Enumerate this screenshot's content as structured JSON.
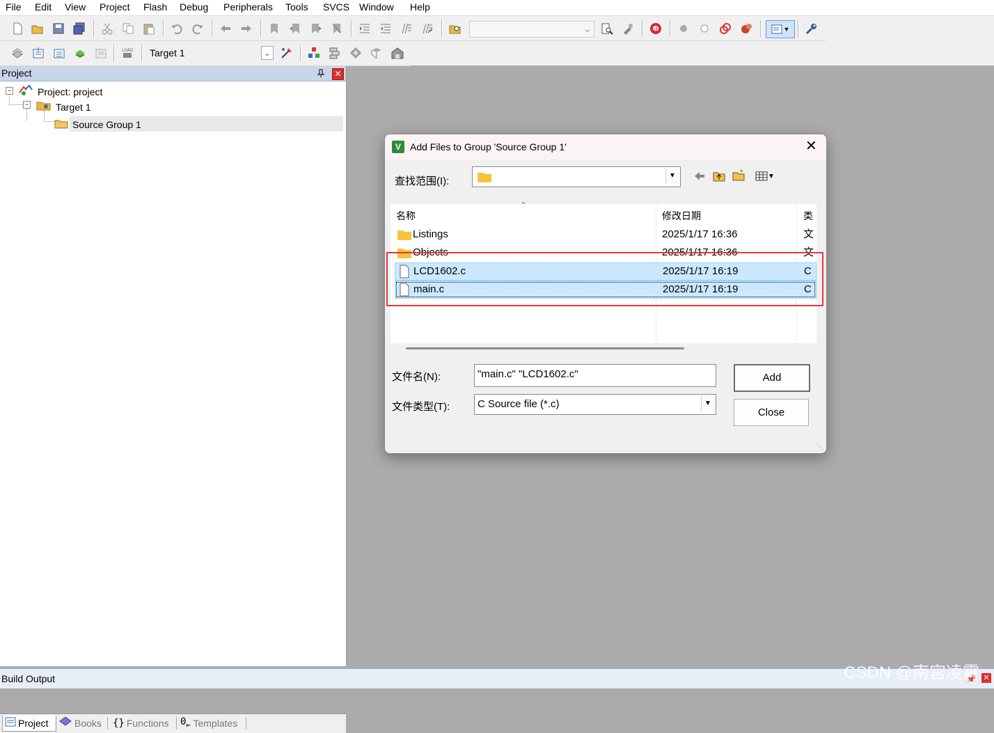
{
  "menu": [
    "File",
    "Edit",
    "View",
    "Project",
    "Flash",
    "Debug",
    "Peripherals",
    "Tools",
    "SVCS",
    "Window",
    "Help"
  ],
  "toolbar": {
    "target_select": "Target 1",
    "search_value": ""
  },
  "project_panel": {
    "title": "Project",
    "pin": "↑",
    "close": "✕",
    "tree": {
      "root": "Project: project",
      "target": "Target 1",
      "group": "Source Group 1"
    },
    "tabs": [
      "Project",
      "Books",
      "Functions",
      "Templates"
    ]
  },
  "build_output": {
    "title": "Build Output"
  },
  "dialog": {
    "title": "Add Files to Group 'Source Group 1'",
    "lookin_label": "查找范围(I):",
    "lookin_value": "",
    "columns": {
      "name": "名称",
      "date": "修改日期",
      "type": "类"
    },
    "files": [
      {
        "name": "Listings",
        "date": "2025/1/17 16:36",
        "type": "文",
        "kind": "folder",
        "selected": false
      },
      {
        "name": "Objects",
        "date": "2025/1/17 16:36",
        "type": "文",
        "kind": "folder",
        "selected": false
      },
      {
        "name": "LCD1602.c",
        "date": "2025/1/17 16:19",
        "type": "C :",
        "kind": "file",
        "selected": true
      },
      {
        "name": "main.c",
        "date": "2025/1/17 16:19",
        "type": "C :",
        "kind": "file",
        "selected": true
      }
    ],
    "filename_label": "文件名(N):",
    "filename_value": "\"main.c\" \"LCD1602.c\"",
    "filetype_label": "文件类型(T):",
    "filetype_value": "C Source file (*.c)",
    "add_button": "Add",
    "close_button": "Close"
  },
  "watermark": "CSDN @南宫凌霄",
  "colors": {
    "accent": "#cce8ff",
    "highlight_box": "#e5373c",
    "panel_header": "#c9d6ea",
    "workspace": "#ababab"
  }
}
